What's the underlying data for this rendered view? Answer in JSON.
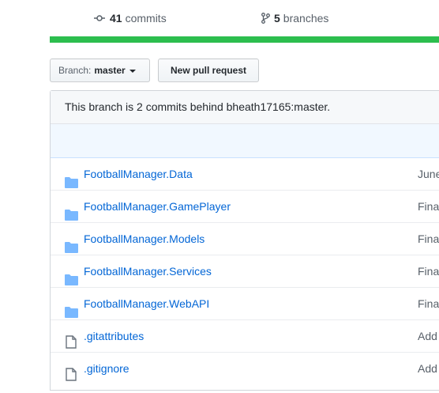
{
  "stats": {
    "commits": {
      "count": "41",
      "label": "commits"
    },
    "branches": {
      "count": "5",
      "label": "branches"
    }
  },
  "language_bar": {
    "color": "#2cbe4e",
    "fill_fraction": 1.0
  },
  "branch_select": {
    "label": "Branch:",
    "value": "master"
  },
  "new_pr_button": "New pull request",
  "behind_message": "This branch is 2 commits behind bheath17165:master.",
  "files": [
    {
      "name": "FootballManager.Data",
      "type": "folder",
      "message": "June"
    },
    {
      "name": "FootballManager.GamePlayer",
      "type": "folder",
      "message": "Fina"
    },
    {
      "name": "FootballManager.Models",
      "type": "folder",
      "message": "Fina"
    },
    {
      "name": "FootballManager.Services",
      "type": "folder",
      "message": "Fina"
    },
    {
      "name": "FootballManager.WebAPI",
      "type": "folder",
      "message": "Fina"
    },
    {
      "name": ".gitattributes",
      "type": "file",
      "message": "Add"
    },
    {
      "name": ".gitignore",
      "type": "file",
      "message": "Add"
    }
  ]
}
